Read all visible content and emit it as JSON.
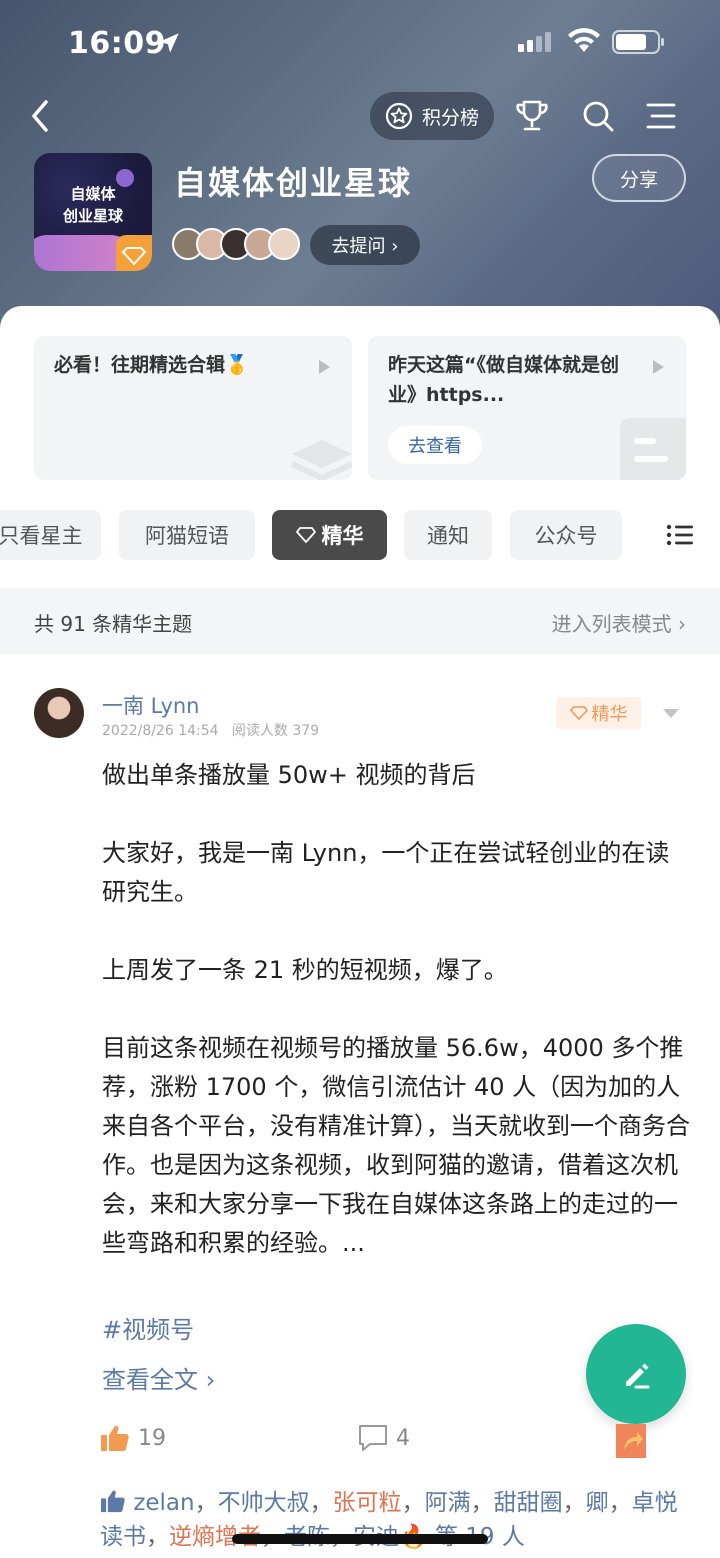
{
  "status_bar": {
    "time": "16:09"
  },
  "nav": {
    "rank_label": "积分榜"
  },
  "group": {
    "title": "自媒体创业星球",
    "avatar_text": "自媒体\n创业星球",
    "share_label": "分享",
    "ask_label": "去提问 ›"
  },
  "cards": [
    {
      "title": "必看！往期精选合辑🥇",
      "button": ""
    },
    {
      "title": "昨天这篇“《做自媒体就是创业》https...",
      "button": "去查看"
    }
  ],
  "tabs": [
    "只看星主",
    "阿猫短语",
    "精华",
    "通知",
    "公众号"
  ],
  "count_bar": {
    "left": "共 91 条精华主题",
    "right": "进入列表模式 ›"
  },
  "post": {
    "author": "一南 Lynn",
    "meta": "2022/8/26 14:54   阅读人数 379",
    "badge": "精华",
    "paragraphs": [
      "做出单条播放量 50w+ 视频的背后",
      "大家好，我是一南 Lynn，一个正在尝试轻创业的在读研究生。",
      "上周发了一条 21 秒的短视频，爆了。",
      "目前这条视频在视频号的播放量 56.6w，4000 多个推荐，涨粉 1700 个，微信引流估计 40 人（因为加的人来自各个平台，没有精准计算），当天就收到一个商务合作。也是因为这条视频，收到阿猫的邀请，借着这次机会，来和大家分享一下我在自媒体这条路上的走过的一些弯路和积累的经验。..."
    ],
    "tag": "#视频号",
    "read_more": "查看全文 ›",
    "like_count": "19",
    "comment_count": "4"
  },
  "likers": {
    "names": [
      "zelan",
      "不帅大叔",
      "张可粒",
      "阿满",
      "甜甜圈",
      "卿",
      "卓悦读书",
      "逆熵增者",
      "老陈",
      "安迪🔥"
    ],
    "highlight": [
      "张可粒",
      "逆熵增者"
    ],
    "suffix": "等 19 人"
  },
  "colors": {
    "accent_green": "#22b693",
    "link_blue": "#5b7aa5",
    "badge_orange": "#f09a55"
  }
}
